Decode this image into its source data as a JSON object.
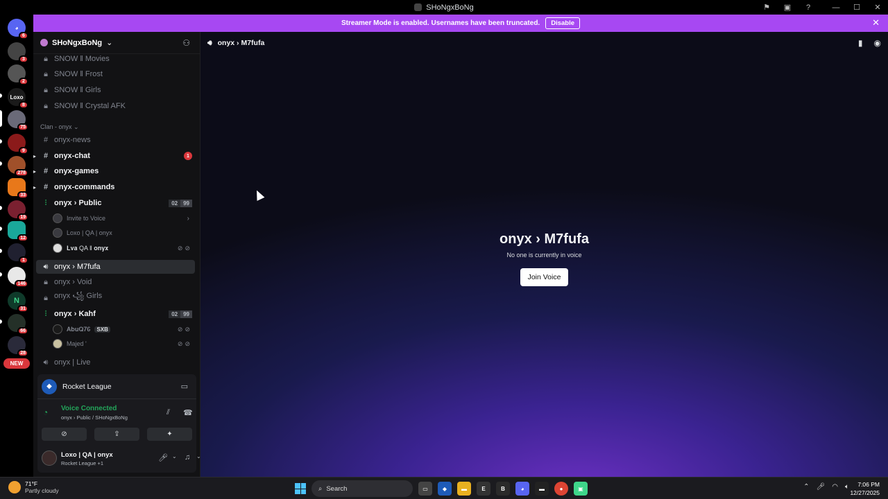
{
  "window": {
    "title": "SHoNgxBoNg"
  },
  "banner": {
    "text": "Streamer Mode is enabled. Usernames have been truncated.",
    "button": "Disable"
  },
  "server_badges": [
    "6",
    "3",
    "2",
    "8",
    "75",
    "9",
    "278",
    "33",
    "19",
    "12",
    "1",
    "146",
    "31",
    "66",
    "28"
  ],
  "server_labels": {
    "loxo": "Loxo"
  },
  "new_badge": "NEW",
  "guild": {
    "name": "SHoNgxBoNg"
  },
  "channels": {
    "snow": [
      "SNOW ‖ Movies",
      "SNOW ‖ Frost",
      "SNOW ‖ Girls",
      "SNOW ‖ Crystal AFK"
    ],
    "category": "Clan - onyx",
    "onyx_news": "onyx-news",
    "onyx_chat": "onyx-chat",
    "onyx_chat_unread": "1",
    "onyx_games": "onyx-games",
    "onyx_commands": "onyx-commands",
    "public": {
      "name": "onyx › Public",
      "count": "02",
      "limit": "99"
    },
    "invite": "Invite to Voice",
    "member1": "Loxo | QA | onyx",
    "member2": "𝐋𝐯𝐚 QA ‖ 𝐨𝐧𝐲𝐱",
    "m7fufa": "onyx › M7fufa",
    "void": "onyx › Void",
    "girls": "onyx ꧁ Girls",
    "kahf": {
      "name": "onyx › Kahf",
      "count": "02",
      "limit": "99"
    },
    "member3": "𝐀𝐛𝐮𝐐𝟕𝟔",
    "member3_tag": "SXB",
    "member4": "Majed '",
    "live": "onyx | Live"
  },
  "activity": {
    "game": "Rocket League"
  },
  "voice": {
    "status": "Voice Connected",
    "location": "onyx › Public / SHoNgxBoNg"
  },
  "user": {
    "name": "Loxo | QA | onyx",
    "status": "Rocket League +1"
  },
  "main": {
    "header": "onyx › M7fufa",
    "title": "onyx › M7fufa",
    "subtitle": "No one is currently in voice",
    "join_button": "Join Voice"
  },
  "taskbar": {
    "temp": "71°F",
    "weather": "Partly cloudy",
    "search": "Search",
    "time": "7:06 PM",
    "date": "12/27/2025"
  }
}
